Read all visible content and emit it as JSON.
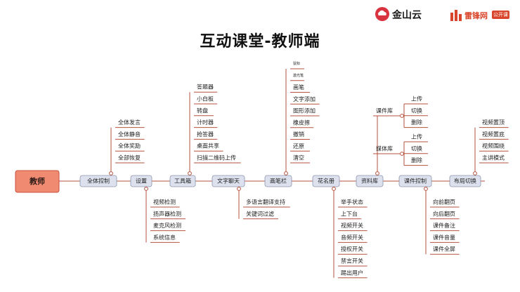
{
  "header": {
    "title": "互动课堂-教师端",
    "logo_kingsoft": "金山云",
    "logo_leifeng": "雷锋网",
    "logo_leifeng_badge": "公开课",
    "brand_colors": {
      "kingsoft": "#d9333f",
      "leifeng": "#d9452a"
    }
  },
  "diagram": {
    "root": "教师",
    "colors": {
      "root_fill": "#f08a70",
      "root_border": "#c9503c",
      "node_fill": "#dde1ee",
      "node_border": "#8c95ad",
      "line": "#b5523f",
      "circle": "#b5523f"
    },
    "nodes": [
      {
        "label": "全体控制",
        "above": [
          "全体发言",
          "全体静音",
          "全体奖励",
          "全部恢复"
        ],
        "below": []
      },
      {
        "label": "设置",
        "above": [],
        "below": [
          "视频检测",
          "扬声器检测",
          "麦克风检测",
          "系统信息"
        ]
      },
      {
        "label": "工具箱",
        "above": [
          "答题器",
          "小白板",
          "转盘",
          "计时器",
          "抢答器",
          "桌面共享",
          "扫描二维码上传"
        ],
        "below": []
      },
      {
        "label": "文字聊天",
        "above": [],
        "below": [
          "多语言翻译支持",
          "关键词过滤"
        ]
      },
      {
        "label": "画笔栏",
        "above": [
          "鼠标",
          "激光笔",
          "画笔",
          "文字添加",
          "图形添加",
          "橡皮擦",
          "撤销",
          "还原",
          "清空"
        ],
        "below": []
      },
      {
        "label": "花名册",
        "above": [],
        "below": [
          "举手状态",
          "上下台",
          "视频开关",
          "音频开关",
          "授权开关",
          "禁言开关",
          "踢出用户"
        ]
      },
      {
        "label": "资料库",
        "above": [],
        "below": [],
        "groups": [
          {
            "label": "课件库",
            "items": [
              "上传",
              "切换",
              "删除"
            ]
          },
          {
            "label": "媒体库",
            "items": [
              "上传",
              "切换",
              "删除"
            ]
          }
        ]
      },
      {
        "label": "课件控制",
        "above": [],
        "below": [
          "向前翻页",
          "向后翻页",
          "课件备注",
          "课件音量",
          "课件全屏"
        ]
      },
      {
        "label": "布局切换",
        "above": [
          "视频置顶",
          "视频置底",
          "视频围绕",
          "主讲模式"
        ],
        "below": []
      }
    ]
  }
}
